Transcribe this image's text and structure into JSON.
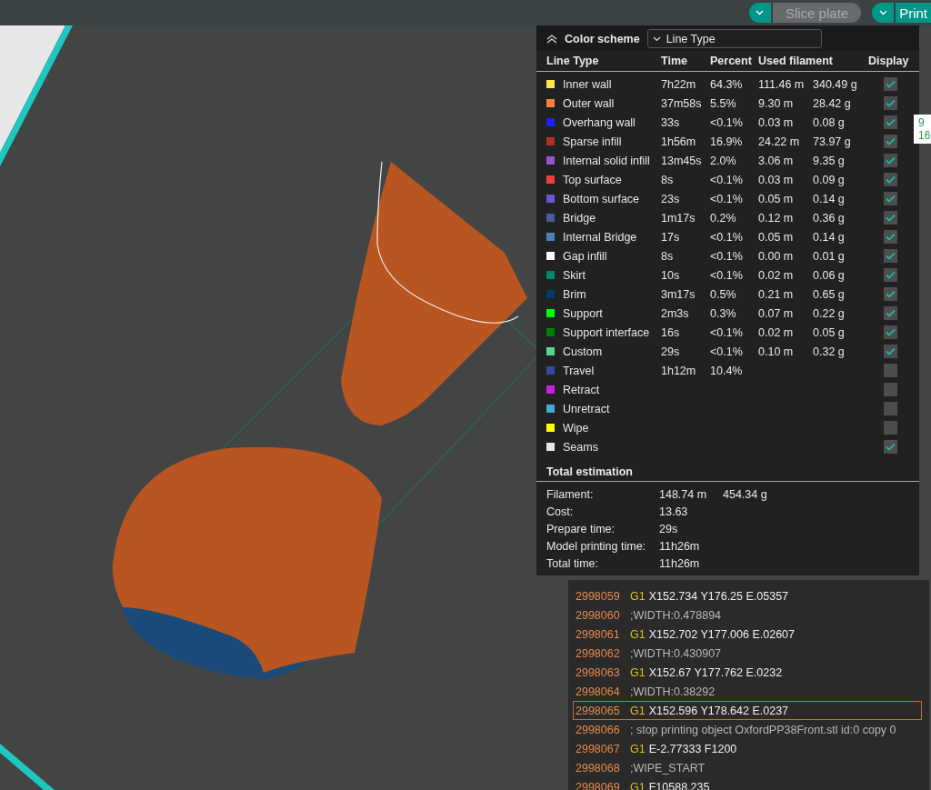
{
  "toolbar": {
    "buttons": [
      {
        "label": "Slice plate",
        "disabled": true
      },
      {
        "label": "Print",
        "disabled": false
      }
    ]
  },
  "legend": {
    "title": "Color scheme",
    "scheme": "Line Type",
    "expanded": true,
    "columns": [
      "Line Type",
      "Time",
      "Percent",
      "Used filament",
      "Display"
    ],
    "rows": [
      {
        "name": "Inner wall",
        "color": "#ffe64d",
        "time": "7h22m",
        "percent": "64.3%",
        "length": "111.46 m",
        "weight": "340.49 g",
        "checked": true
      },
      {
        "name": "Outer wall",
        "color": "#ff7f3c",
        "time": "37m58s",
        "percent": "5.5%",
        "length": "9.30 m",
        "weight": "28.42 g",
        "checked": true
      },
      {
        "name": "Overhang wall",
        "color": "#1f1fff",
        "time": "33s",
        "percent": "<0.1%",
        "length": "0.03 m",
        "weight": "0.08 g",
        "checked": true
      },
      {
        "name": "Sparse infill",
        "color": "#b0302e",
        "time": "1h56m",
        "percent": "16.9%",
        "length": "24.22 m",
        "weight": "73.97 g",
        "checked": true
      },
      {
        "name": "Internal solid infill",
        "color": "#9654cc",
        "time": "13m45s",
        "percent": "2.0%",
        "length": "3.06 m",
        "weight": "9.35 g",
        "checked": true
      },
      {
        "name": "Top surface",
        "color": "#f03c3c",
        "time": "8s",
        "percent": "<0.1%",
        "length": "0.03 m",
        "weight": "0.09 g",
        "checked": true
      },
      {
        "name": "Bottom surface",
        "color": "#6a5acd",
        "time": "23s",
        "percent": "<0.1%",
        "length": "0.05 m",
        "weight": "0.14 g",
        "checked": true
      },
      {
        "name": "Bridge",
        "color": "#4d5aa0",
        "time": "1m17s",
        "percent": "0.2%",
        "length": "0.12 m",
        "weight": "0.36 g",
        "checked": true
      },
      {
        "name": "Internal Bridge",
        "color": "#4d80ba",
        "time": "17s",
        "percent": "<0.1%",
        "length": "0.05 m",
        "weight": "0.14 g",
        "checked": true
      },
      {
        "name": "Gap infill",
        "color": "#ffffff",
        "time": "8s",
        "percent": "<0.1%",
        "length": "0.00 m",
        "weight": "0.01 g",
        "checked": true
      },
      {
        "name": "Skirt",
        "color": "#00876e",
        "time": "10s",
        "percent": "<0.1%",
        "length": "0.02 m",
        "weight": "0.06 g",
        "checked": true
      },
      {
        "name": "Brim",
        "color": "#003c6e",
        "time": "3m17s",
        "percent": "0.5%",
        "length": "0.21 m",
        "weight": "0.65 g",
        "checked": true
      },
      {
        "name": "Support",
        "color": "#00ff00",
        "time": "2m3s",
        "percent": "0.3%",
        "length": "0.07 m",
        "weight": "0.22 g",
        "checked": true
      },
      {
        "name": "Support interface",
        "color": "#008000",
        "time": "16s",
        "percent": "<0.1%",
        "length": "0.02 m",
        "weight": "0.05 g",
        "checked": true
      },
      {
        "name": "Custom",
        "color": "#5ed194",
        "time": "29s",
        "percent": "<0.1%",
        "length": "0.10 m",
        "weight": "0.32 g",
        "checked": true
      },
      {
        "name": "Travel",
        "color": "#3c46a0",
        "time": "1h12m",
        "percent": "10.4%",
        "checked": false
      },
      {
        "name": "Retract",
        "color": "#cd1fdf",
        "checked": false
      },
      {
        "name": "Unretract",
        "color": "#46aad2",
        "checked": false
      },
      {
        "name": "Wipe",
        "color": "#ffff00",
        "checked": false
      },
      {
        "name": "Seams",
        "color": "#e6e6e6",
        "checked": true
      }
    ],
    "total": {
      "title": "Total estimation",
      "items": [
        {
          "label": "Filament:",
          "values": [
            "148.74 m",
            "454.34 g"
          ]
        },
        {
          "label": "Cost:",
          "values": [
            "13.63"
          ]
        },
        {
          "label": "Prepare time:",
          "values": [
            "29s"
          ]
        },
        {
          "label": "Model printing time:",
          "values": [
            "11h26m"
          ]
        },
        {
          "label": "Total time:",
          "values": [
            "11h26m"
          ]
        }
      ]
    }
  },
  "side_label": [
    "9",
    "16"
  ],
  "gcode": {
    "lines": [
      {
        "number": "2998059",
        "kind": "move",
        "command": "G1",
        "args": "X152.734 Y176.25 E.05357",
        "selected": false
      },
      {
        "number": "2998060",
        "kind": "comment",
        "text": ";WIDTH:0.478894",
        "selected": false
      },
      {
        "number": "2998061",
        "kind": "move",
        "command": "G1",
        "args": "X152.702 Y177.006 E.02607",
        "selected": false
      },
      {
        "number": "2998062",
        "kind": "comment",
        "text": ";WIDTH:0.430907",
        "selected": false
      },
      {
        "number": "2998063",
        "kind": "move",
        "command": "G1",
        "args": "X152.67 Y177.762 E.0232",
        "selected": false
      },
      {
        "number": "2998064",
        "kind": "comment",
        "text": ";WIDTH:0.38292",
        "selected": false
      },
      {
        "number": "2998065",
        "kind": "move",
        "command": "G1",
        "args": "X152.596 Y178.642 E.0237",
        "selected": true
      },
      {
        "number": "2998066",
        "kind": "comment",
        "text": "; stop printing object OxfordPP38Front.stl id:0 copy 0",
        "selected": false
      },
      {
        "number": "2998067",
        "kind": "move",
        "command": "G1",
        "args": "E-2.77333 F1200",
        "selected": false
      },
      {
        "number": "2998068",
        "kind": "comment",
        "text": ";WIPE_START",
        "selected": false
      },
      {
        "number": "2998069",
        "kind": "move",
        "command": "G1",
        "args": "F10588.235",
        "selected": false
      }
    ]
  }
}
